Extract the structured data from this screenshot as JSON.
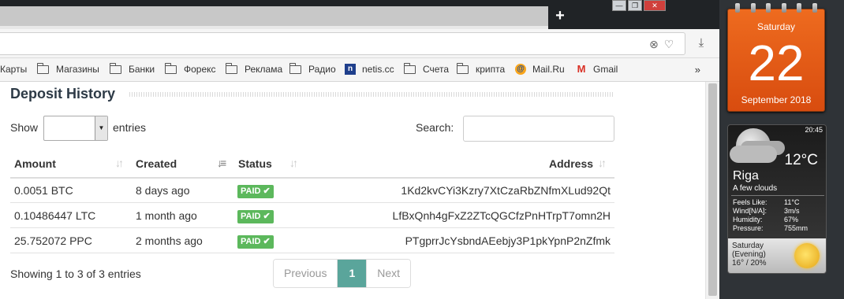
{
  "browser": {
    "new_tab_label": "+",
    "window_buttons": [
      "—",
      "❐",
      "✕"
    ]
  },
  "bookmarks": [
    {
      "label": "Карты",
      "icon": "folder-icon"
    },
    {
      "label": "Магазины",
      "icon": "folder-icon"
    },
    {
      "label": "Банки",
      "icon": "folder-icon"
    },
    {
      "label": "Форекс",
      "icon": "folder-icon"
    },
    {
      "label": "Реклама",
      "icon": "folder-icon"
    },
    {
      "label": "Радио",
      "icon": "folder-icon"
    },
    {
      "label": "netis.cc",
      "icon": "netis-icon"
    },
    {
      "label": "Счета",
      "icon": "folder-icon"
    },
    {
      "label": "крипта",
      "icon": "folder-icon"
    },
    {
      "label": "Mail.Ru",
      "icon": "mailru-icon"
    },
    {
      "label": "Gmail",
      "icon": "gmail-icon"
    }
  ],
  "bookmarks_more": "»",
  "page": {
    "title": "Deposit History",
    "show_label": "Show",
    "entries_label": "entries",
    "page_size_value": "",
    "search_label": "Search:",
    "search_value": "",
    "columns": [
      "Amount",
      "Created",
      "Status",
      "Address"
    ],
    "rows": [
      {
        "amount": "0.0051 BTC",
        "created": "8 days ago",
        "status": "PAID",
        "address": "1Kd2kvCYi3Kzry7XtCzaRbZNfmXLud92Qt"
      },
      {
        "amount": "0.10486447 LTC",
        "created": "1 month ago",
        "status": "PAID",
        "address": "LfBxQnh4gFxZ2ZTcQGCfzPnHTrpT7omn2H"
      },
      {
        "amount": "25.752072 PPC",
        "created": "2 months ago",
        "status": "PAID",
        "address": "PTgprrJcYsbndAEebjy3P1pkYpnP2nZfmk"
      }
    ],
    "info": "Showing 1 to 3 of 3 entries",
    "pagination": {
      "previous": "Previous",
      "current": "1",
      "next": "Next"
    },
    "colors": {
      "paid": "#5cb85c",
      "current_page": "#5aa59b"
    }
  },
  "calendar": {
    "day": "Saturday",
    "date": "22",
    "month_year": "September 2018",
    "color": "#e8601a"
  },
  "weather": {
    "time": "20:45",
    "temp": "12°C",
    "city": "Riga",
    "description": "A few clouds",
    "stats": [
      {
        "label": "Feels Like:",
        "value": "11°C"
      },
      {
        "label": "Wind[N/A]:",
        "value": "3m/s"
      },
      {
        "label": "Humidity:",
        "value": "67%"
      },
      {
        "label": "Pressure:",
        "value": "755mm"
      }
    ],
    "forecast_day": "Saturday",
    "forecast_period": "(Evening)",
    "forecast_temps": "16° / 20%"
  }
}
